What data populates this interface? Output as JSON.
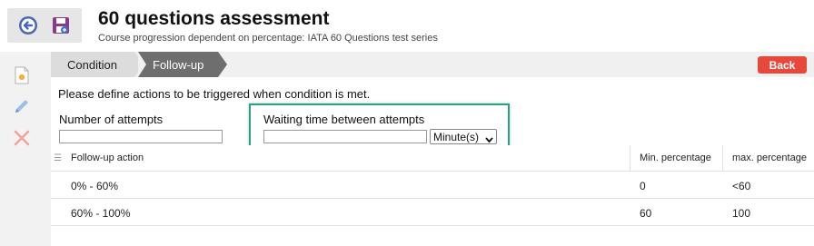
{
  "header": {
    "title": "60 questions assessment",
    "subtitle": "Course progression dependent on percentage: IATA 60 Questions test series"
  },
  "toolbar": {
    "back_icon": "circle-arrow-left-icon",
    "save_icon": "floppy-disk-icon"
  },
  "sidebar": {
    "icons": [
      "new-document-icon",
      "pencil-icon",
      "delete-x-icon"
    ]
  },
  "tabs": [
    {
      "label": "Condition",
      "active": false
    },
    {
      "label": "Follow-up",
      "active": true
    }
  ],
  "back_button": {
    "label": "Back",
    "color": "#e8473c"
  },
  "form": {
    "instruction": "Please define actions to be triggered when condition is met.",
    "attempts_label": "Number of attempts",
    "attempts_value": "",
    "waiting_label": "Waiting time between attempts",
    "waiting_value": "",
    "unit_selected": "Minute(s)"
  },
  "grid": {
    "columns": [
      "Follow-up action",
      "Min. percentage",
      "max. percentage"
    ],
    "rows": [
      {
        "action": "0% - 60%",
        "min": "0",
        "max": "<60"
      },
      {
        "action": "60% - 100%",
        "min": "60",
        "max": "100"
      }
    ]
  },
  "colors": {
    "accent": "#2e9e85",
    "tab_active": "#6e6e6e",
    "tab_inactive": "#dcdcdc"
  }
}
